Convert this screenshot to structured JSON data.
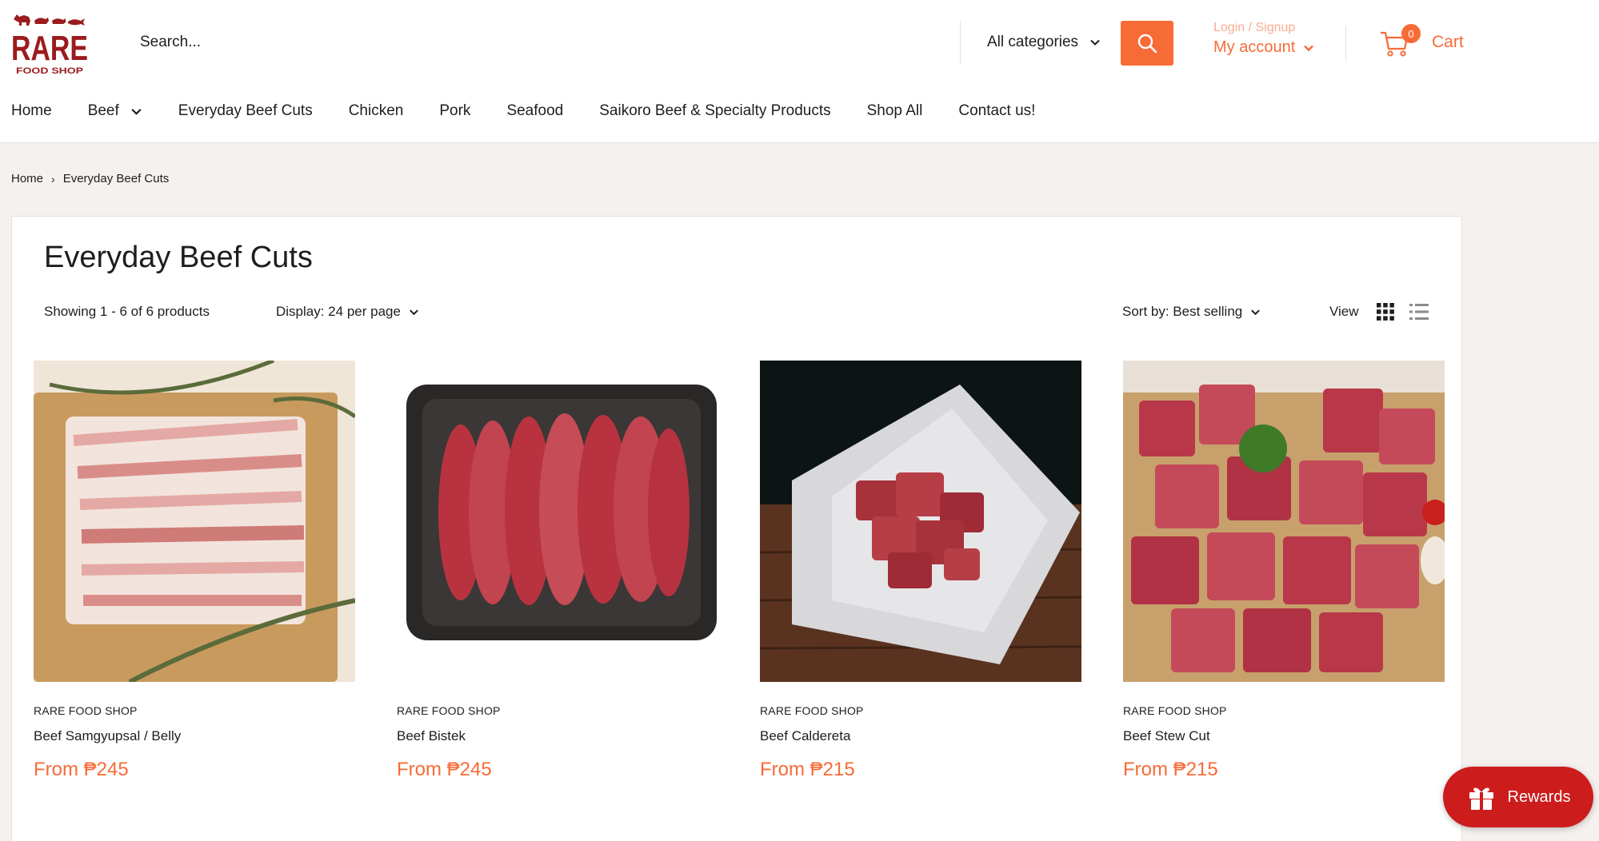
{
  "header": {
    "logo": {
      "brand": "RARE",
      "sub": "FOOD SHOP"
    },
    "search": {
      "placeholder": "Search..."
    },
    "category_select": "All categories",
    "account": {
      "login_label": "Login / Signup",
      "my_account_label": "My account"
    },
    "cart": {
      "count": "0",
      "label": "Cart"
    },
    "colors": {
      "accent": "#f76b37",
      "brand_red": "#9b1b1e",
      "rewards_red": "#cc1c1c"
    }
  },
  "nav": {
    "items": [
      {
        "label": "Home"
      },
      {
        "label": "Beef"
      },
      {
        "label": "Everyday Beef Cuts"
      },
      {
        "label": "Chicken"
      },
      {
        "label": "Pork"
      },
      {
        "label": "Seafood"
      },
      {
        "label": "Saikoro Beef & Specialty Products"
      },
      {
        "label": "Shop All"
      },
      {
        "label": "Contact us!"
      }
    ]
  },
  "breadcrumb": {
    "home": "Home",
    "separator": "›",
    "current": "Everyday Beef Cuts"
  },
  "collection": {
    "title": "Everyday Beef Cuts",
    "showing": "Showing 1 - 6 of 6 products",
    "display": "Display: 24 per page",
    "sort": "Sort by: Best selling",
    "view_label": "View"
  },
  "products": [
    {
      "vendor": "RARE FOOD SHOP",
      "name": "Beef Samgyupsal / Belly",
      "price": "From ₱245"
    },
    {
      "vendor": "RARE FOOD SHOP",
      "name": "Beef Bistek",
      "price": "From ₱245"
    },
    {
      "vendor": "RARE FOOD SHOP",
      "name": "Beef Caldereta",
      "price": "From ₱215"
    },
    {
      "vendor": "RARE FOOD SHOP",
      "name": "Beef Stew Cut",
      "price": "From ₱215"
    }
  ],
  "rewards": {
    "label": "Rewards"
  }
}
